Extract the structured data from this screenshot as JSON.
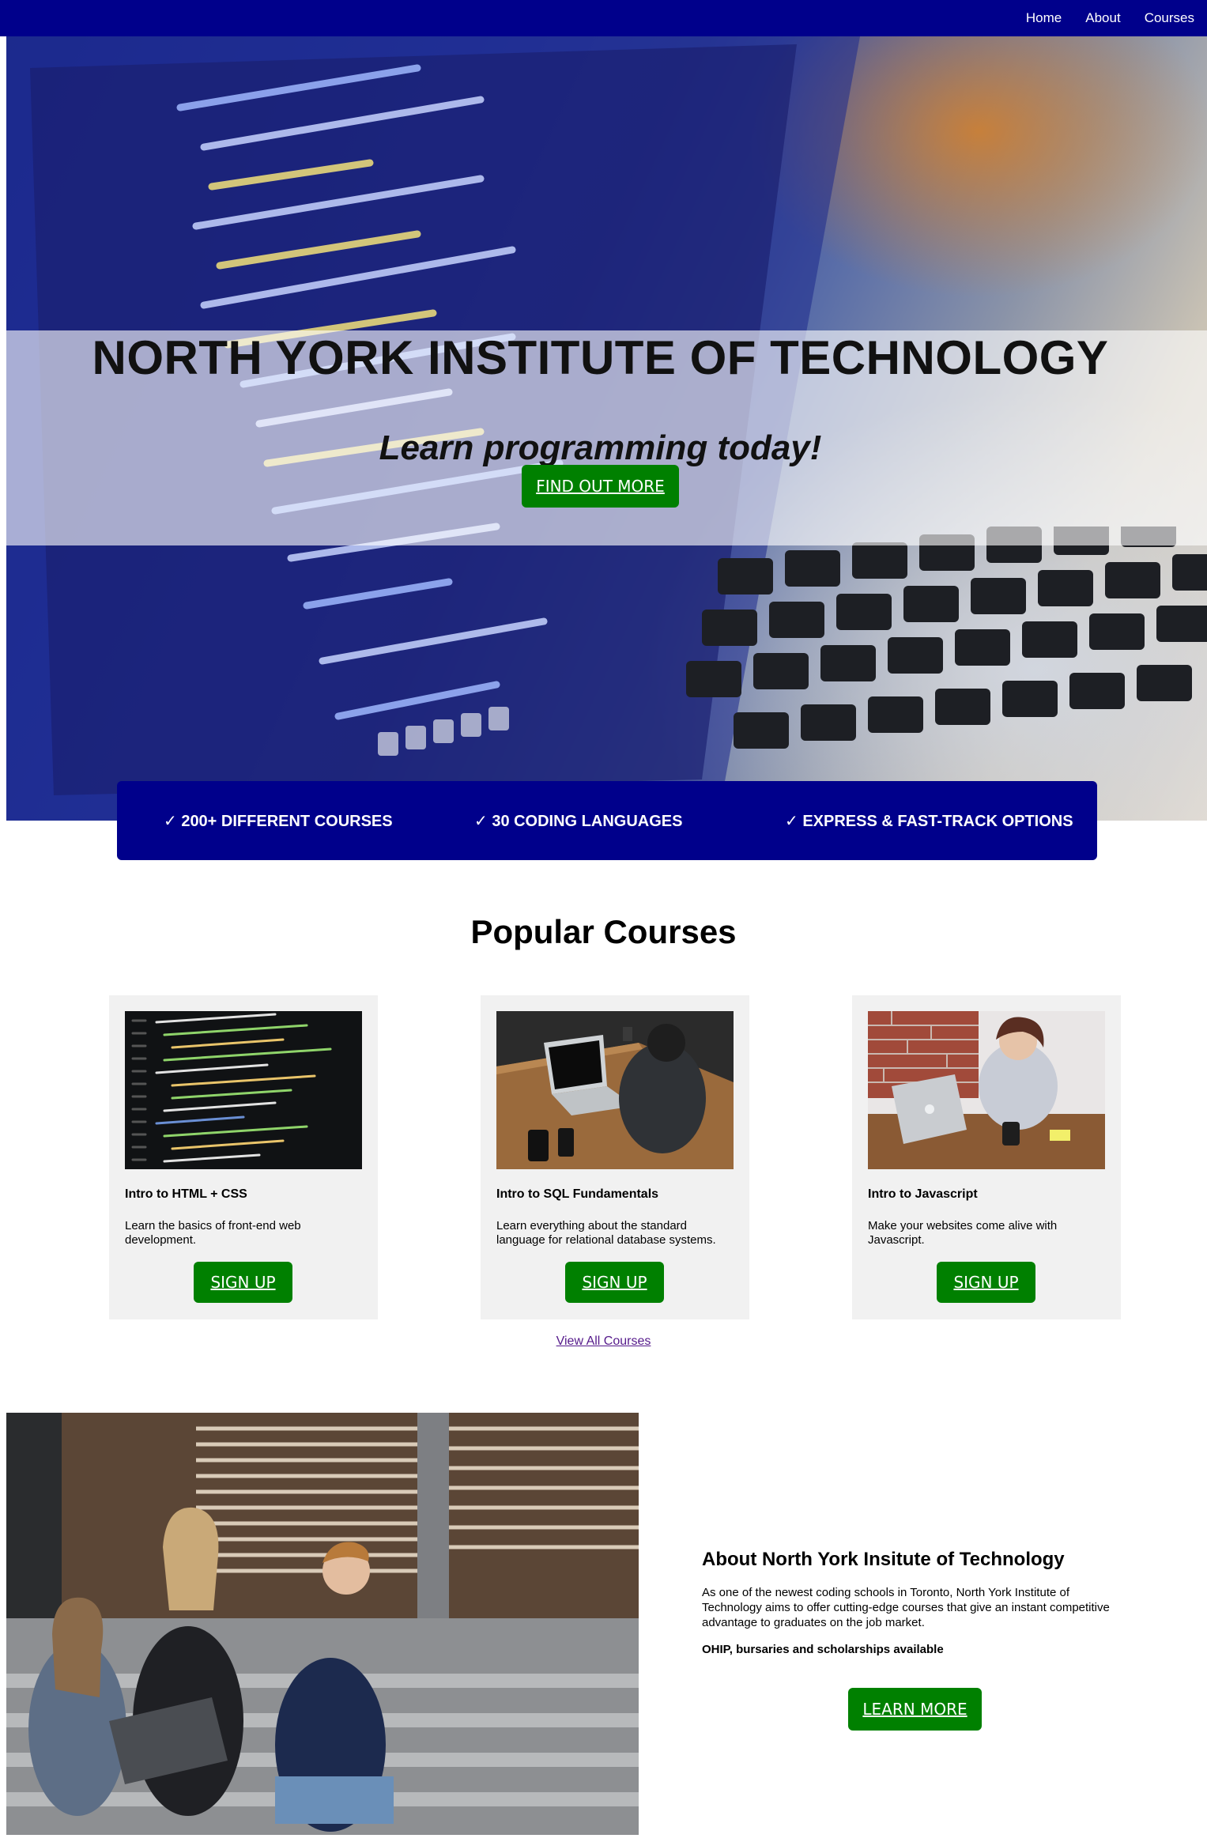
{
  "nav": {
    "links": [
      "Home",
      "About",
      "Courses"
    ]
  },
  "hero": {
    "title": "NORTH YORK INSTITUTE OF TECHNOLOGY",
    "subtitle": "Learn programming today!",
    "button": "FIND OUT MORE"
  },
  "features": [
    "✓ 200+ DIFFERENT COURSES",
    "✓ 30 CODING LANGUAGES",
    "✓ EXPRESS & FAST-TRACK OPTIONS"
  ],
  "courses": {
    "title": "Popular Courses",
    "items": [
      {
        "title": "Intro to HTML + CSS",
        "description": "Learn the basics of front-end web development.",
        "button": "SIGN UP"
      },
      {
        "title": "Intro to SQL Fundamentals",
        "description": "Learn everything about the standard language for relational database systems.",
        "button": "SIGN UP"
      },
      {
        "title": "Intro to Javascript",
        "description": "Make your websites come alive with Javascript.",
        "button": "SIGN UP"
      }
    ],
    "view_all": "View All Courses"
  },
  "about": {
    "title": "About North York Insitute of Technology",
    "text": "As one of the newest coding schools in Toronto, North York Institute of Technology aims to offer cutting-edge courses that give an instant competitive advantage to graduates on the job market.",
    "note": "OHIP, bursaries and scholarships available",
    "button": "LEARN MORE"
  },
  "colors": {
    "nav_bg": "#00008b",
    "button_green": "#008000",
    "card_bg": "#f1f1f1",
    "link_visited": "#551a8b"
  }
}
